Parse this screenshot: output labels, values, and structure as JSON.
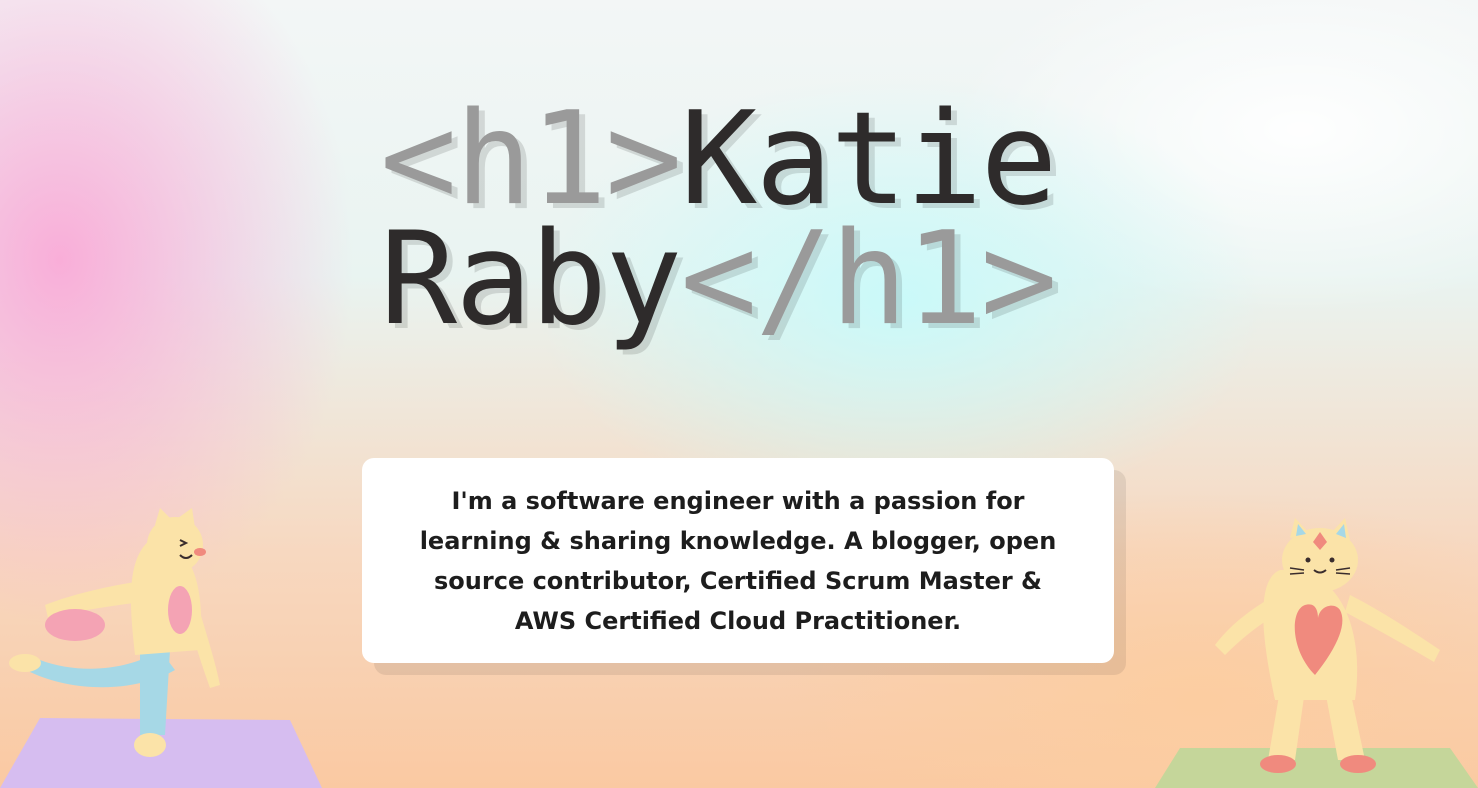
{
  "heading": {
    "open_tag": "<h1>",
    "name_first": "Katie",
    "name_last": "Raby",
    "close_tag": "</h1>"
  },
  "bio": {
    "text": "I'm a software engineer with a passion for learning & sharing knowledge. A blogger, open source contributor, Certified Scrum Master & AWS Certified Cloud Practitioner."
  },
  "colors": {
    "tag_gray": "#9a9a9a",
    "name_dark": "#2e2b2b",
    "mat_purple": "#d6bdf0",
    "mat_green": "#c5d69a",
    "cat_body": "#fbe3a8",
    "heart": "#f08a7e",
    "pants": "#a6d8e6"
  },
  "illustrations": {
    "left": "cat-yoga-pose-icon",
    "right": "cat-standing-heart-icon"
  }
}
